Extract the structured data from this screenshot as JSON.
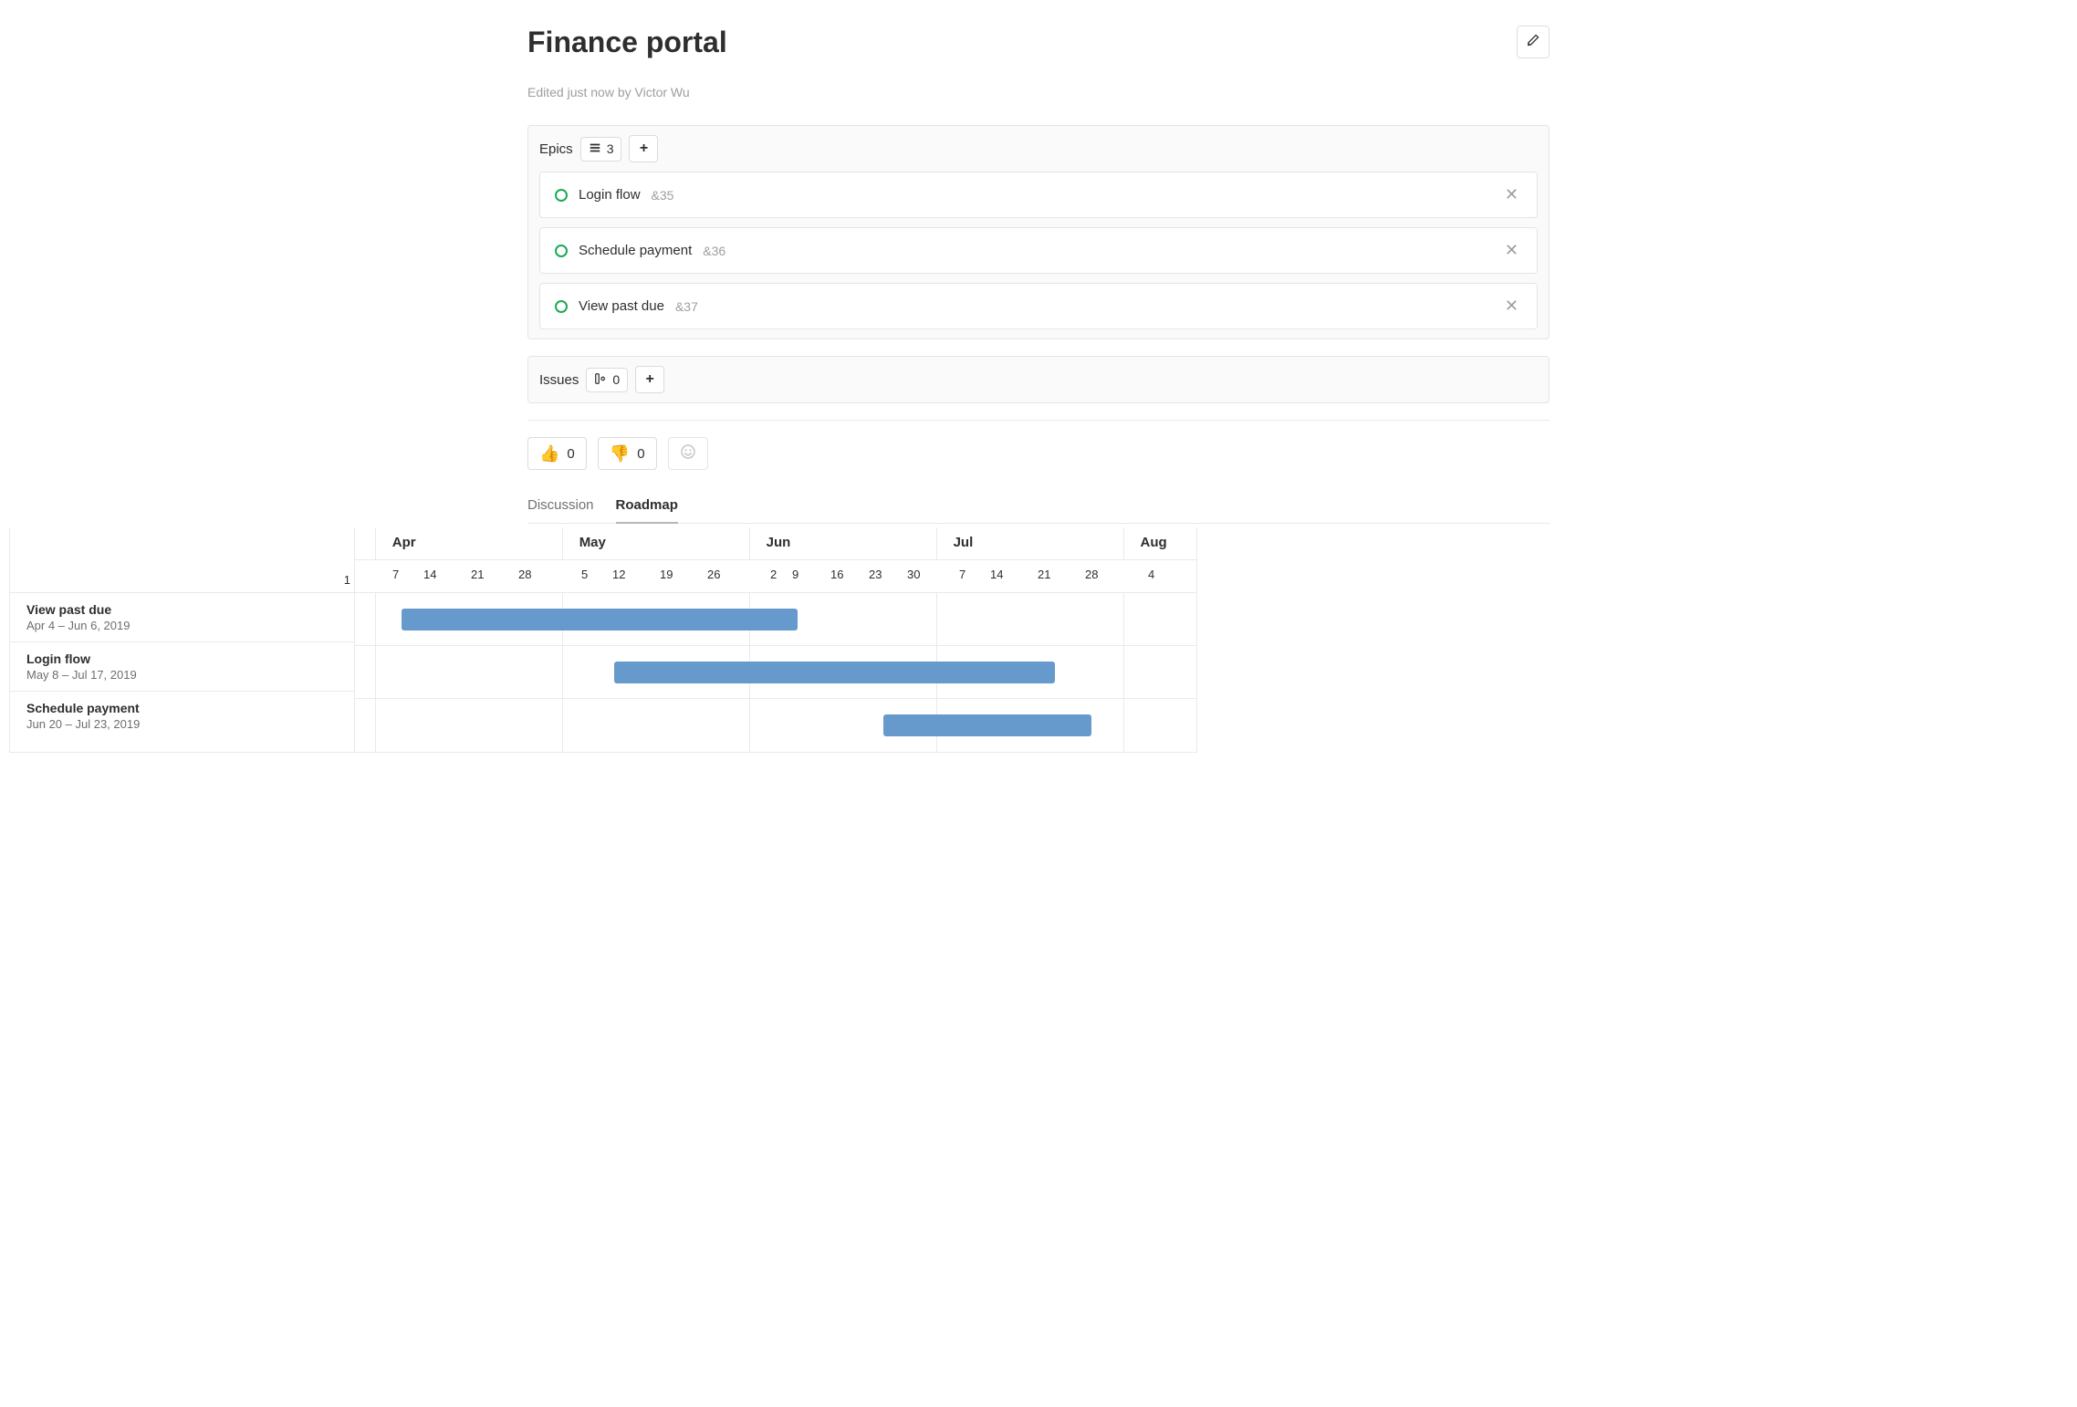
{
  "header": {
    "title": "Finance portal",
    "subtitle": "Edited just now by Victor Wu"
  },
  "epics_panel": {
    "label": "Epics",
    "count": "3",
    "items": [
      {
        "title": "Login flow",
        "ref": "&35"
      },
      {
        "title": "Schedule payment",
        "ref": "&36"
      },
      {
        "title": "View past due",
        "ref": "&37"
      }
    ]
  },
  "issues_panel": {
    "label": "Issues",
    "count": "0"
  },
  "reactions": {
    "thumbs_up_count": "0",
    "thumbs_down_count": "0"
  },
  "tabs": {
    "discussion": "Discussion",
    "roadmap": "Roadmap"
  },
  "roadmap": {
    "leading_day": "1",
    "months": [
      "Apr",
      "May",
      "Jun",
      "Jul",
      "Aug"
    ],
    "weeks": [
      "7",
      "14",
      "21",
      "28",
      "5",
      "12",
      "19",
      "26",
      "2",
      "9",
      "16",
      "23",
      "30",
      "7",
      "14",
      "21",
      "28",
      "4"
    ],
    "rows": [
      {
        "title": "View past due",
        "dates": "Apr 4 – Jun 6, 2019"
      },
      {
        "title": "Login flow",
        "dates": "May 8 – Jul 17, 2019"
      },
      {
        "title": "Schedule payment",
        "dates": "Jun 20 – Jul 23, 2019"
      }
    ]
  },
  "chart_data": {
    "type": "gantt",
    "x_axis": "date",
    "x_range": [
      "2019-03-31",
      "2019-08-10"
    ],
    "series": [
      {
        "name": "View past due",
        "start": "2019-04-04",
        "end": "2019-06-06"
      },
      {
        "name": "Login flow",
        "start": "2019-05-08",
        "end": "2019-07-17"
      },
      {
        "name": "Schedule payment",
        "start": "2019-06-20",
        "end": "2019-07-23"
      }
    ],
    "month_ticks": [
      "Apr",
      "May",
      "Jun",
      "Jul",
      "Aug"
    ],
    "week_ticks": [
      7,
      14,
      21,
      28,
      5,
      12,
      19,
      26,
      2,
      9,
      16,
      23,
      30,
      7,
      14,
      21,
      28,
      4
    ]
  }
}
